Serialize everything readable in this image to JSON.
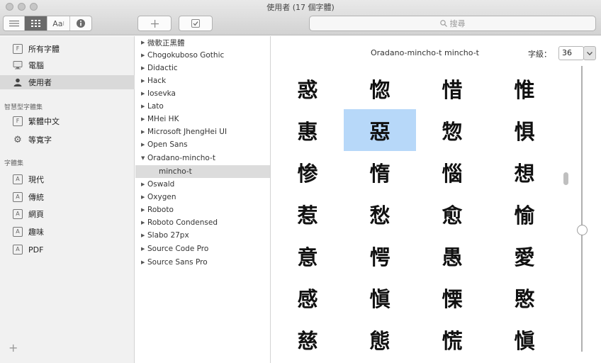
{
  "window": {
    "title": "使用者 (17 個字體)"
  },
  "toolbar": {
    "view_aa_label": "Aa",
    "search_placeholder": "搜尋"
  },
  "sidebar": {
    "items": [
      {
        "label": "所有字體"
      },
      {
        "label": "電腦"
      },
      {
        "label": "使用者"
      }
    ],
    "smart_heading": "智慧型字體集",
    "smart_items": [
      {
        "label": "繁體中文"
      },
      {
        "label": "等寬字"
      }
    ],
    "collections_heading": "字體集",
    "collection_items": [
      {
        "label": "現代"
      },
      {
        "label": "傳統"
      },
      {
        "label": "網頁"
      },
      {
        "label": "趣味"
      },
      {
        "label": "PDF"
      }
    ],
    "add_label": "+"
  },
  "font_list": [
    {
      "label": "微軟正黑體"
    },
    {
      "label": "Chogokuboso Gothic"
    },
    {
      "label": "Didactic"
    },
    {
      "label": "Hack"
    },
    {
      "label": "Iosevka"
    },
    {
      "label": "Lato"
    },
    {
      "label": "MHei HK"
    },
    {
      "label": "Microsoft JhengHei UI"
    },
    {
      "label": "Open Sans"
    },
    {
      "label": "Oradano-mincho-t"
    },
    {
      "label": "mincho-t"
    },
    {
      "label": "Oswald"
    },
    {
      "label": "Oxygen"
    },
    {
      "label": "Roboto"
    },
    {
      "label": "Roboto Condensed"
    },
    {
      "label": "Slabo 27px"
    },
    {
      "label": "Source Code Pro"
    },
    {
      "label": "Source Sans Pro"
    }
  ],
  "preview": {
    "font_name": "Oradano-mincho-t mincho-t",
    "size_label": "字級：",
    "size_value": "36",
    "glyphs": [
      "惑",
      "惚",
      "惜",
      "惟",
      "惠",
      "惡",
      "惣",
      "惧",
      "惨",
      "惰",
      "惱",
      "想",
      "惹",
      "愁",
      "愈",
      "愉",
      "意",
      "愕",
      "愚",
      "愛",
      "感",
      "愼",
      "慄",
      "愍",
      "慈",
      "態",
      "慌",
      "愼"
    ]
  },
  "colors": {
    "selection": "#b7d8f9",
    "sidebar_selected": "#d9d9d9"
  }
}
